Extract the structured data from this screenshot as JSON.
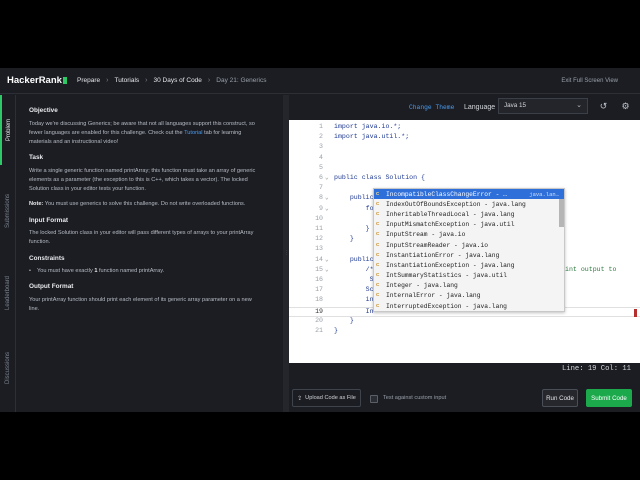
{
  "header": {
    "logo": "HackerRank",
    "breadcrumbs": [
      "Prepare",
      "Tutorials",
      "30 Days of Code",
      "Day 21: Generics"
    ],
    "separator": "›",
    "exit_label": "Exit Full Screen View"
  },
  "side_tabs": [
    "Problem",
    "Submissions",
    "Leaderboard",
    "Discussions"
  ],
  "problem": {
    "objective_title": "Objective",
    "objective_text_1": "Today we're discussing Generics; be aware that not all languages support this construct, so fewer languages are enabled for this challenge. Check out the ",
    "objective_link": "Tutorial",
    "objective_text_2": " tab for learning materials and an instructional video!",
    "task_title": "Task",
    "task_text": "Write a single generic function named printArray; this function must take an array of generic elements as a parameter (the exception to this is C++, which takes a vector). The locked Solution class in your editor tests your function.",
    "note_label": "Note:",
    "note_text": " You must use generics to solve this challenge. Do not write overloaded functions.",
    "input_title": "Input Format",
    "input_text": "The locked Solution class in your editor will pass different types of arrays to your printArray function.",
    "constraints_title": "Constraints",
    "constraint_1_a": "You must have exactly ",
    "constraint_1_b": "1",
    "constraint_1_c": " function named printArray.",
    "output_title": "Output Format",
    "output_text": "Your printArray function should print each element of its generic array parameter on a new line."
  },
  "editor": {
    "change_theme": "Change Theme",
    "language_label": "Language",
    "language_value": "Java 15",
    "lines": [
      {
        "n": "1",
        "fold": "",
        "text": "import java.io.*;"
      },
      {
        "n": "2",
        "fold": "",
        "text": "import java.util.*;"
      },
      {
        "n": "3",
        "fold": "",
        "text": ""
      },
      {
        "n": "4",
        "fold": "",
        "text": ""
      },
      {
        "n": "5",
        "fold": "",
        "text": ""
      },
      {
        "n": "6",
        "fold": "v",
        "text": "public class Solution {"
      },
      {
        "n": "7",
        "fold": "",
        "text": ""
      },
      {
        "n": "8",
        "fold": "v",
        "text": "    public"
      },
      {
        "n": "9",
        "fold": "v",
        "text": "        fo"
      },
      {
        "n": "10",
        "fold": "",
        "text": ""
      },
      {
        "n": "11",
        "fold": "",
        "text": "        }"
      },
      {
        "n": "12",
        "fold": "",
        "text": "    }"
      },
      {
        "n": "13",
        "fold": "",
        "text": ""
      },
      {
        "n": "14",
        "fold": "v",
        "text": "    public"
      },
      {
        "n": "15",
        "fold": "v",
        "text": "        /*"
      },
      {
        "n": "16",
        "fold": "",
        "text": "         ST"
      },
      {
        "n": "17",
        "fold": "",
        "text": "        Sc"
      },
      {
        "n": "18",
        "fold": "",
        "text": "        in"
      },
      {
        "n": "19",
        "fold": "",
        "text": "        In"
      },
      {
        "n": "20",
        "fold": "",
        "text": "    }"
      },
      {
        "n": "21",
        "fold": "",
        "text": "}"
      }
    ],
    "line15_tail": "int output to",
    "autocomplete": [
      {
        "label": "IncompatibleClassChangeError - …",
        "hint": "java.lan…",
        "selected": true
      },
      {
        "label": "IndexOutOfBoundsException - java.lang",
        "hint": "",
        "selected": false
      },
      {
        "label": "InheritableThreadLocal - java.lang",
        "hint": "",
        "selected": false
      },
      {
        "label": "InputMismatchException - java.util",
        "hint": "",
        "selected": false
      },
      {
        "label": "InputStream - java.io",
        "hint": "",
        "selected": false
      },
      {
        "label": "InputStreamReader - java.io",
        "hint": "",
        "selected": false
      },
      {
        "label": "InstantiationError - java.lang",
        "hint": "",
        "selected": false
      },
      {
        "label": "InstantiationException - java.lang",
        "hint": "",
        "selected": false
      },
      {
        "label": "IntSummaryStatistics - java.util",
        "hint": "",
        "selected": false
      },
      {
        "label": "Integer - java.lang",
        "hint": "",
        "selected": false
      },
      {
        "label": "InternalError - java.lang",
        "hint": "",
        "selected": false
      },
      {
        "label": "InterruptedException - java.lang",
        "hint": "",
        "selected": false
      }
    ],
    "ac_icon_text": "C",
    "status": "Line: 19 Col: 11"
  },
  "footer": {
    "upload_label": "Upload Code as File",
    "custom_input_label": "Test against custom input",
    "run_label": "Run Code",
    "submit_label": "Submit Code"
  },
  "colors": {
    "accent_green": "#1ba94c",
    "link_blue": "#4a9cf0",
    "autocomplete_selected": "#2f6fd9"
  }
}
